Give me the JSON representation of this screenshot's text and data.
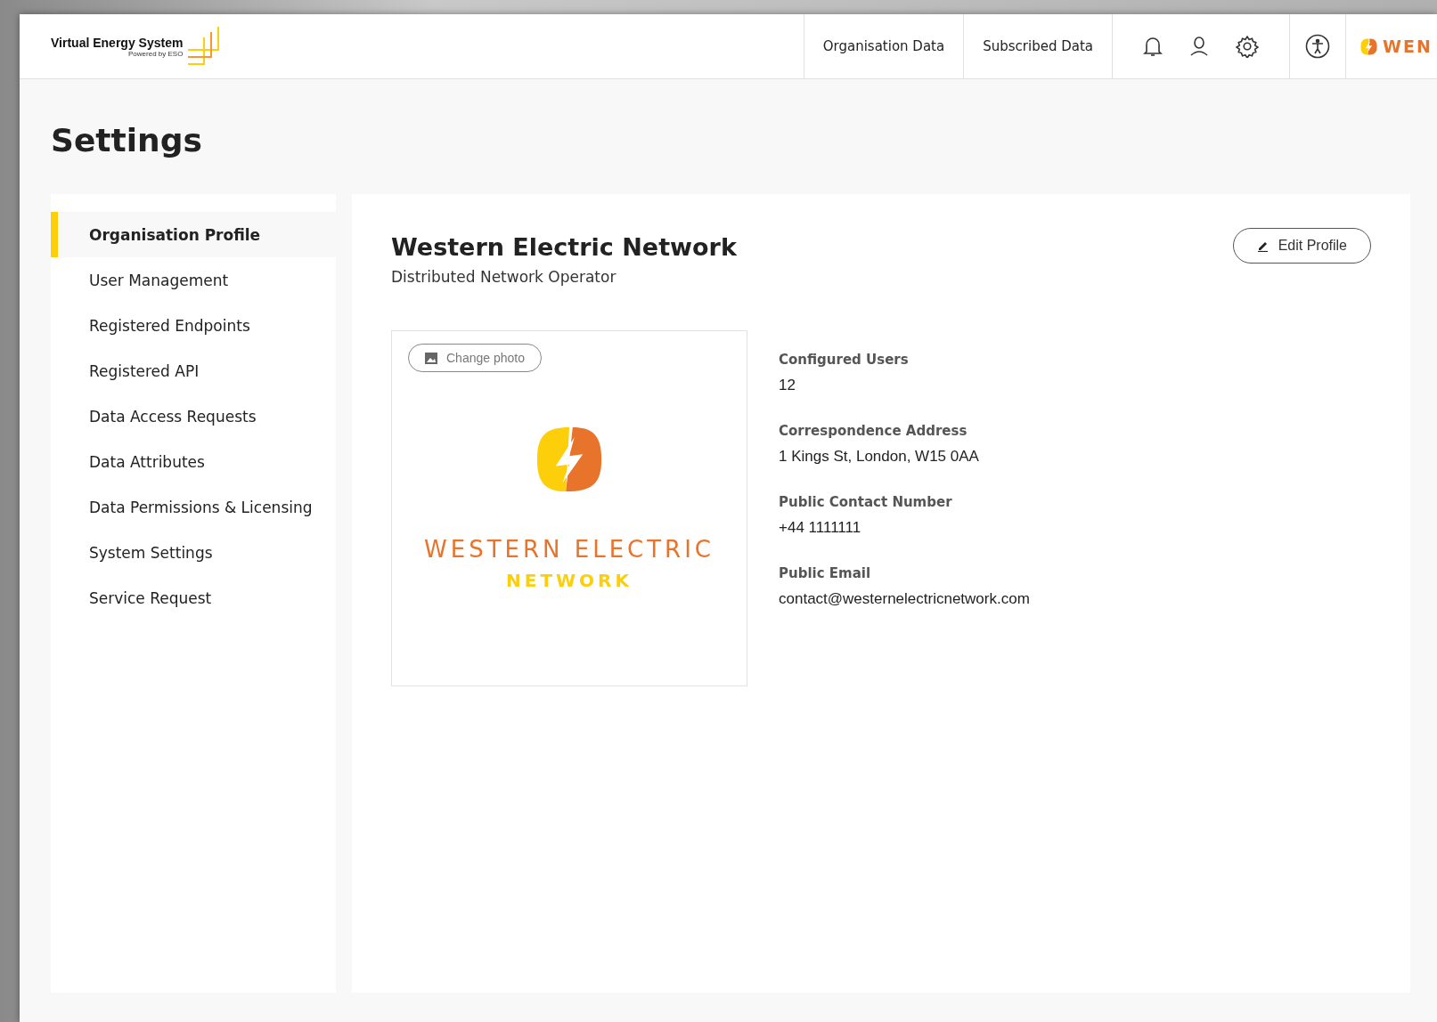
{
  "header": {
    "app_name": "Virtual Energy System",
    "app_tagline": "Powered by ESO",
    "nav": [
      {
        "label": "Organisation Data",
        "selected": false
      },
      {
        "label": "Subscribed Data",
        "selected": false
      }
    ],
    "org_badge": "WEN"
  },
  "page_title": "Settings",
  "sidebar": {
    "items": [
      {
        "label": "Organisation Profile",
        "selected": true
      },
      {
        "label": "User Management",
        "selected": false
      },
      {
        "label": "Registered Endpoints",
        "selected": false
      },
      {
        "label": "Registered API",
        "selected": false
      },
      {
        "label": "Data Access Requests",
        "selected": false
      },
      {
        "label": "Data Attributes",
        "selected": false
      },
      {
        "label": "Data Permissions & Licensing",
        "selected": false
      },
      {
        "label": "System Settings",
        "selected": false
      },
      {
        "label": "Service Request",
        "selected": false
      }
    ]
  },
  "profile": {
    "name": "Western Electric Network",
    "type": "Distributed Network Operator",
    "edit_button": "Edit Profile",
    "change_photo_button": "Change photo",
    "logo_line_1": "WESTERN ELECTRIC",
    "logo_line_2": "NETWORK",
    "fields": [
      {
        "label": "Configured Users",
        "value": "12"
      },
      {
        "label": "Correspondence Address",
        "value": "1 Kings St, London, W15 0AA"
      },
      {
        "label": "Public Contact Number",
        "value": "+44 1111111"
      },
      {
        "label": "Public Email",
        "value": "contact@westernelectricnetwork.com"
      }
    ]
  }
}
